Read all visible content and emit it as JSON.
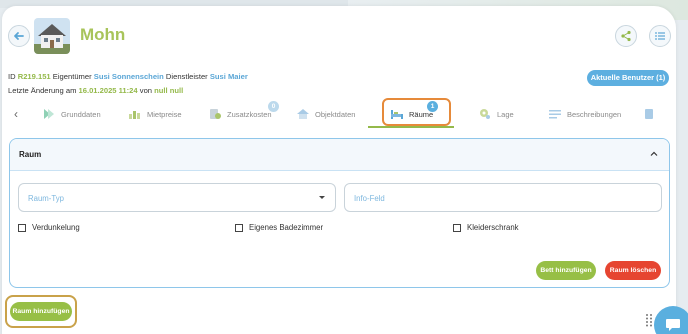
{
  "header": {
    "title": "Mohn",
    "back_icon": "arrow-left-icon",
    "share_icon": "share-icon",
    "list_icon": "list-icon"
  },
  "info": {
    "id_label": "ID",
    "id_value": "R219.151",
    "owner_label": "Eigentümer",
    "owner_value": "Susi Sonnenschein",
    "provider_label": "Dienstleister",
    "provider_value": "Susi Maier",
    "last_change_label": "Letzte Änderung am",
    "last_change_value": "16.01.2025 11:24",
    "by_label": "von",
    "by_value": "null null"
  },
  "users_button": "Aktuelle Benutzer (1)",
  "tabs": [
    {
      "label": "Grunddaten",
      "icon": "grunddaten-icon"
    },
    {
      "label": "Mietpreise",
      "icon": "mietpreise-icon"
    },
    {
      "label": "Zusatzkosten",
      "icon": "zusatzkosten-icon",
      "badge": "0"
    },
    {
      "label": "Objektdaten",
      "icon": "objektdaten-icon"
    },
    {
      "label": "Räume",
      "icon": "bed-icon",
      "badge": "1",
      "active": true
    },
    {
      "label": "Lage",
      "icon": "location-icon"
    },
    {
      "label": "Beschreibungen",
      "icon": "beschreibungen-icon"
    }
  ],
  "panel": {
    "title": "Raum",
    "room_type_placeholder": "Raum-Typ",
    "info_placeholder": "Info-Feld",
    "checkboxes": [
      "Verdunkelung",
      "Eigenes Badezimmer",
      "Kleiderschrank"
    ],
    "add_bed": "Bett hinzufügen",
    "delete_room": "Raum löschen"
  },
  "add_room": "Raum hinzufügen",
  "colors": {
    "accent_green": "#97bf46",
    "accent_blue": "#5aafdf",
    "danger_red": "#e64531",
    "highlight_orange": "#e68a3a"
  }
}
